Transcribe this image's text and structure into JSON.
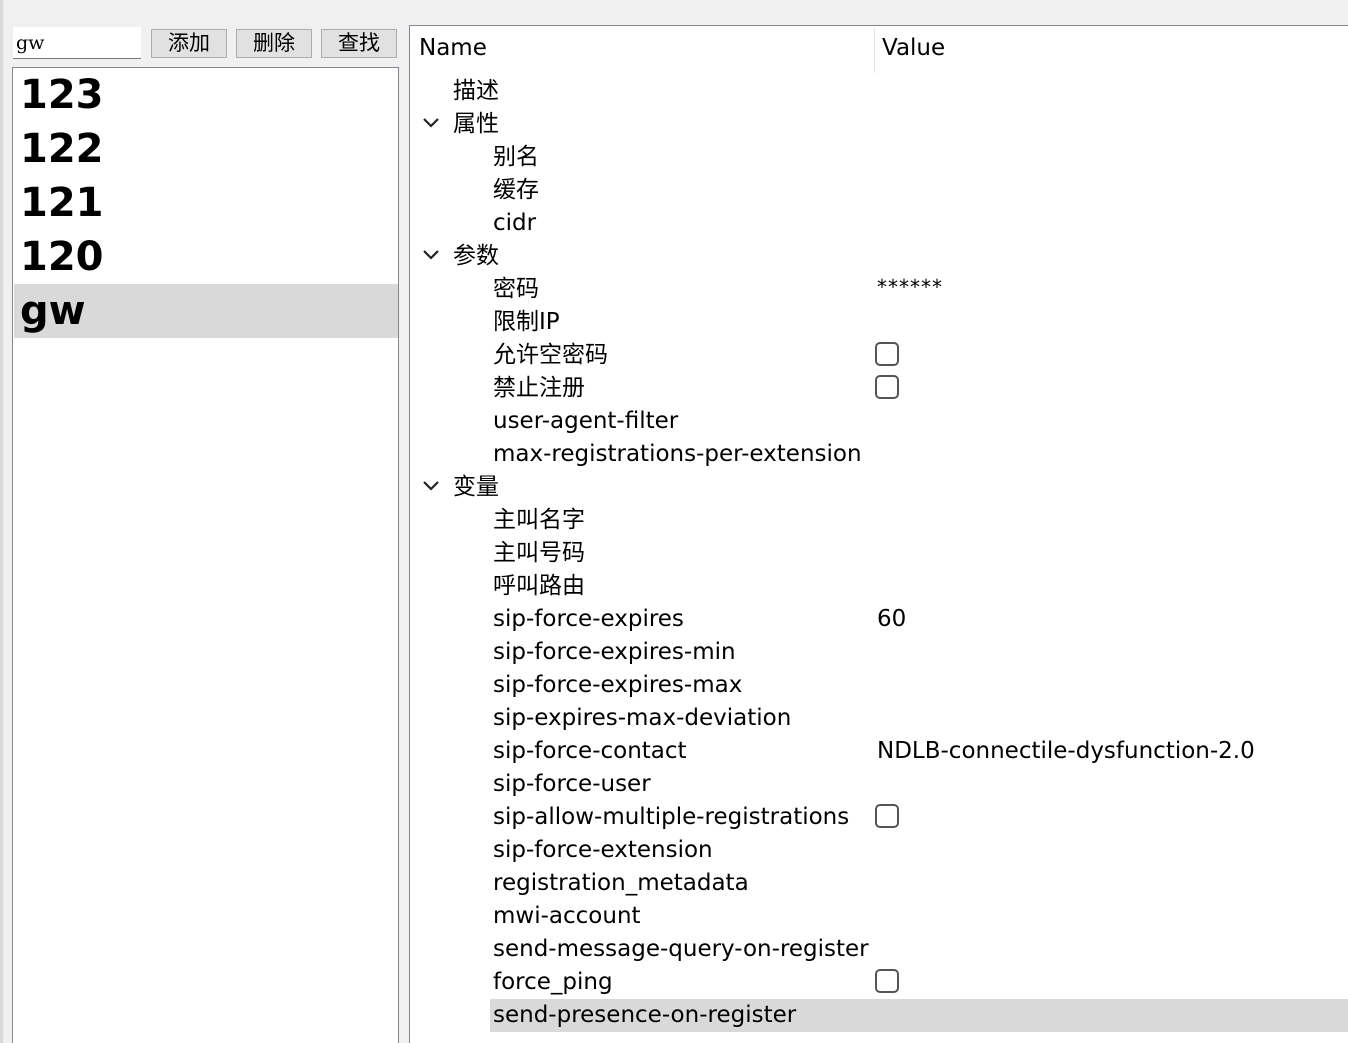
{
  "toolbar": {
    "search_value": "gw",
    "add_label": "添加",
    "delete_label": "删除",
    "find_label": "查找"
  },
  "list": {
    "items": [
      "123",
      "122",
      "121",
      "120",
      "gw"
    ],
    "selected": "gw"
  },
  "grid": {
    "columns": {
      "name": "Name",
      "value": "Value"
    },
    "rows": [
      {
        "label": "描述",
        "level": 0
      },
      {
        "label": "属性",
        "level": 0,
        "expanded": true
      },
      {
        "label": "别名",
        "level": 1
      },
      {
        "label": "缓存",
        "level": 1
      },
      {
        "label": "cidr",
        "level": 1
      },
      {
        "label": "参数",
        "level": 0,
        "expanded": true
      },
      {
        "label": "密码",
        "level": 1,
        "value": "******",
        "password": true
      },
      {
        "label": "限制IP",
        "level": 1
      },
      {
        "label": "允许空密码",
        "level": 1,
        "checkbox": true,
        "checked": false
      },
      {
        "label": "禁止注册",
        "level": 1,
        "checkbox": true,
        "checked": false
      },
      {
        "label": "user-agent-filter",
        "level": 1
      },
      {
        "label": "max-registrations-per-extension",
        "level": 1
      },
      {
        "label": "变量",
        "level": 0,
        "expanded": true
      },
      {
        "label": "主叫名字",
        "level": 1
      },
      {
        "label": "主叫号码",
        "level": 1
      },
      {
        "label": "呼叫路由",
        "level": 1
      },
      {
        "label": "sip-force-expires",
        "level": 1,
        "value": "60"
      },
      {
        "label": "sip-force-expires-min",
        "level": 1
      },
      {
        "label": "sip-force-expires-max",
        "level": 1
      },
      {
        "label": "sip-expires-max-deviation",
        "level": 1
      },
      {
        "label": "sip-force-contact",
        "level": 1,
        "value": "NDLB-connectile-dysfunction-2.0"
      },
      {
        "label": "sip-force-user",
        "level": 1
      },
      {
        "label": "sip-allow-multiple-registrations",
        "level": 1,
        "checkbox": true,
        "checked": false
      },
      {
        "label": "sip-force-extension",
        "level": 1
      },
      {
        "label": "registration_metadata",
        "level": 1
      },
      {
        "label": "mwi-account",
        "level": 1
      },
      {
        "label": "send-message-query-on-register",
        "level": 1
      },
      {
        "label": "force_ping",
        "level": 1,
        "checkbox": true,
        "checked": false
      },
      {
        "label": "send-presence-on-register",
        "level": 1,
        "selected": true
      }
    ]
  }
}
